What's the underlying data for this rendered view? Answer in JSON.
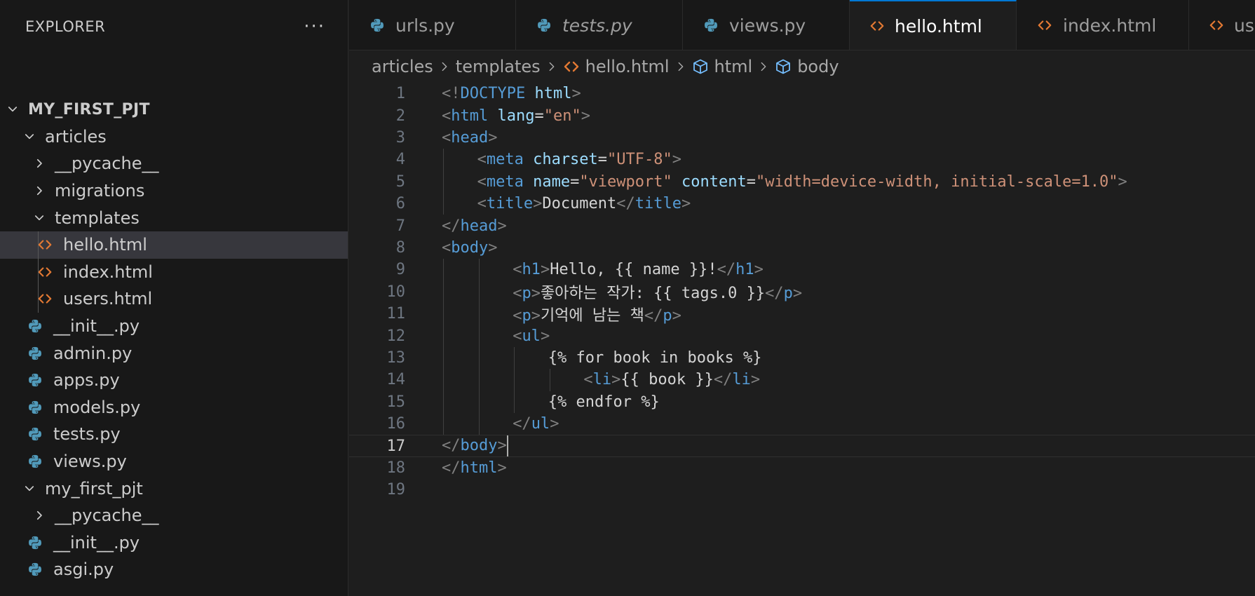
{
  "sidebar": {
    "title": "EXPLORER",
    "more": "···",
    "items": [
      {
        "label": "MY_FIRST_PJT",
        "type": "root",
        "depth": 0,
        "expanded": true
      },
      {
        "label": "articles",
        "type": "folder",
        "depth": 1,
        "expanded": true
      },
      {
        "label": "__pycache__",
        "type": "folder",
        "depth": 2,
        "expanded": false
      },
      {
        "label": "migrations",
        "type": "folder",
        "depth": 2,
        "expanded": false
      },
      {
        "label": "templates",
        "type": "folder",
        "depth": 2,
        "expanded": true
      },
      {
        "label": "hello.html",
        "type": "html",
        "depth": 3,
        "selected": true
      },
      {
        "label": "index.html",
        "type": "html",
        "depth": 3
      },
      {
        "label": "users.html",
        "type": "html",
        "depth": 3
      },
      {
        "label": "__init__.py",
        "type": "python",
        "depth": 2
      },
      {
        "label": "admin.py",
        "type": "python",
        "depth": 2
      },
      {
        "label": "apps.py",
        "type": "python",
        "depth": 2
      },
      {
        "label": "models.py",
        "type": "python",
        "depth": 2
      },
      {
        "label": "tests.py",
        "type": "python",
        "depth": 2
      },
      {
        "label": "views.py",
        "type": "python",
        "depth": 2
      },
      {
        "label": "my_first_pjt",
        "type": "folder",
        "depth": 1,
        "expanded": true
      },
      {
        "label": "__pycache__",
        "type": "folder",
        "depth": 2,
        "expanded": false
      },
      {
        "label": "__init__.py",
        "type": "python",
        "depth": 2
      },
      {
        "label": "asgi.py",
        "type": "python",
        "depth": 2
      }
    ]
  },
  "tabs": [
    {
      "label": "urls.py",
      "type": "python"
    },
    {
      "label": "tests.py",
      "type": "python",
      "italic": true
    },
    {
      "label": "views.py",
      "type": "python"
    },
    {
      "label": "hello.html",
      "type": "html",
      "active": true,
      "dirty": true
    },
    {
      "label": "index.html",
      "type": "html"
    },
    {
      "label": "us",
      "type": "html"
    }
  ],
  "breadcrumb": [
    "articles",
    "templates",
    "hello.html",
    "html",
    "body"
  ],
  "editor": {
    "current_line": 17,
    "lines": [
      {
        "n": "1",
        "indent": 0,
        "tokens": [
          [
            "br",
            "<!"
          ],
          [
            "tag",
            "DOCTYPE"
          ],
          [
            "txt",
            " "
          ],
          [
            "attr",
            "html"
          ],
          [
            "br",
            ">"
          ]
        ]
      },
      {
        "n": "2",
        "indent": 0,
        "tokens": [
          [
            "br",
            "<"
          ],
          [
            "tag",
            "html"
          ],
          [
            "txt",
            " "
          ],
          [
            "attr",
            "lang"
          ],
          [
            "txt",
            "="
          ],
          [
            "str",
            "\"en\""
          ],
          [
            "br",
            ">"
          ]
        ]
      },
      {
        "n": "3",
        "indent": 0,
        "tokens": [
          [
            "br",
            "<"
          ],
          [
            "tag",
            "head"
          ],
          [
            "br",
            ">"
          ]
        ]
      },
      {
        "n": "4",
        "indent": 1,
        "tokens": [
          [
            "br",
            "<"
          ],
          [
            "tag",
            "meta"
          ],
          [
            "txt",
            " "
          ],
          [
            "attr",
            "charset"
          ],
          [
            "txt",
            "="
          ],
          [
            "str",
            "\"UTF-8\""
          ],
          [
            "br",
            ">"
          ]
        ]
      },
      {
        "n": "5",
        "indent": 1,
        "tokens": [
          [
            "br",
            "<"
          ],
          [
            "tag",
            "meta"
          ],
          [
            "txt",
            " "
          ],
          [
            "attr",
            "name"
          ],
          [
            "txt",
            "="
          ],
          [
            "str",
            "\"viewport\""
          ],
          [
            "txt",
            " "
          ],
          [
            "attr",
            "content"
          ],
          [
            "txt",
            "="
          ],
          [
            "str",
            "\"width=device-width, initial-scale=1.0\""
          ],
          [
            "br",
            ">"
          ]
        ]
      },
      {
        "n": "6",
        "indent": 1,
        "tokens": [
          [
            "br",
            "<"
          ],
          [
            "tag",
            "title"
          ],
          [
            "br",
            ">"
          ],
          [
            "txt",
            "Document"
          ],
          [
            "br",
            "</"
          ],
          [
            "tag",
            "title"
          ],
          [
            "br",
            ">"
          ]
        ]
      },
      {
        "n": "7",
        "indent": 0,
        "tokens": [
          [
            "br",
            "</"
          ],
          [
            "tag",
            "head"
          ],
          [
            "br",
            ">"
          ]
        ]
      },
      {
        "n": "8",
        "indent": 0,
        "tokens": [
          [
            "br",
            "<"
          ],
          [
            "tag",
            "body"
          ],
          [
            "br",
            ">"
          ]
        ]
      },
      {
        "n": "9",
        "indent": 2,
        "tokens": [
          [
            "br",
            "<"
          ],
          [
            "tag",
            "h1"
          ],
          [
            "br",
            ">"
          ],
          [
            "txt",
            "Hello, {{ name }}!"
          ],
          [
            "br",
            "</"
          ],
          [
            "tag",
            "h1"
          ],
          [
            "br",
            ">"
          ]
        ]
      },
      {
        "n": "10",
        "indent": 2,
        "tokens": [
          [
            "br",
            "<"
          ],
          [
            "tag",
            "p"
          ],
          [
            "br",
            ">"
          ],
          [
            "txt",
            "좋아하는 작가: {{ tags.0 }}"
          ],
          [
            "br",
            "</"
          ],
          [
            "tag",
            "p"
          ],
          [
            "br",
            ">"
          ]
        ]
      },
      {
        "n": "11",
        "indent": 2,
        "tokens": [
          [
            "br",
            "<"
          ],
          [
            "tag",
            "p"
          ],
          [
            "br",
            ">"
          ],
          [
            "txt",
            "기억에 남는 책"
          ],
          [
            "br",
            "</"
          ],
          [
            "tag",
            "p"
          ],
          [
            "br",
            ">"
          ]
        ]
      },
      {
        "n": "12",
        "indent": 2,
        "tokens": [
          [
            "br",
            "<"
          ],
          [
            "tag",
            "ul"
          ],
          [
            "br",
            ">"
          ]
        ]
      },
      {
        "n": "13",
        "indent": 3,
        "tokens": [
          [
            "txt",
            "{% for book in books %}"
          ]
        ]
      },
      {
        "n": "14",
        "indent": 4,
        "tokens": [
          [
            "br",
            "<"
          ],
          [
            "tag",
            "li"
          ],
          [
            "br",
            ">"
          ],
          [
            "txt",
            "{{ book }}"
          ],
          [
            "br",
            "</"
          ],
          [
            "tag",
            "li"
          ],
          [
            "br",
            ">"
          ]
        ]
      },
      {
        "n": "15",
        "indent": 3,
        "tokens": [
          [
            "txt",
            "{% endfor %}"
          ]
        ]
      },
      {
        "n": "16",
        "indent": 2,
        "tokens": [
          [
            "br",
            "</"
          ],
          [
            "tag",
            "ul"
          ],
          [
            "br",
            ">"
          ]
        ]
      },
      {
        "n": "17",
        "indent": 0,
        "tokens": [
          [
            "br",
            "</"
          ],
          [
            "tag",
            "body"
          ],
          [
            "br",
            ">"
          ]
        ]
      },
      {
        "n": "18",
        "indent": 0,
        "tokens": [
          [
            "br",
            "</"
          ],
          [
            "tag",
            "html"
          ],
          [
            "br",
            ">"
          ]
        ]
      },
      {
        "n": "19",
        "indent": 0,
        "tokens": []
      }
    ]
  },
  "colors": {
    "accent": "#0078d4",
    "html_icon": "#e37933",
    "python_icon": "#519aba"
  },
  "icons": {
    "html": "code-brackets-icon",
    "python": "python-icon",
    "folder_open": "chevron-down-icon",
    "folder_closed": "chevron-right-icon",
    "element": "symbol-cube-icon"
  }
}
